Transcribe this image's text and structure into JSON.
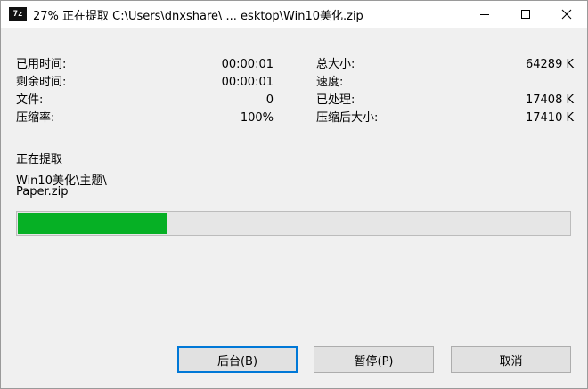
{
  "window": {
    "icon_text": "7z",
    "title": "27% 正在提取 C:\\Users\\dnxshare\\ ... esktop\\Win10美化.zip",
    "controls": [
      "minimize",
      "maximize",
      "close"
    ]
  },
  "stats_left": [
    {
      "label": "已用时间:",
      "value": "00:00:01"
    },
    {
      "label": "剩余时间:",
      "value": "00:00:01"
    },
    {
      "label": "文件:",
      "value": "0"
    },
    {
      "label": "压缩率:",
      "value": "100%"
    }
  ],
  "stats_right": [
    {
      "label": "总大小:",
      "value": "64289 K"
    },
    {
      "label": "速度:",
      "value": ""
    },
    {
      "label": "已处理:",
      "value": "17408 K"
    },
    {
      "label": "压缩后大小:",
      "value": "17410 K"
    }
  ],
  "status": {
    "label": "正在提取",
    "path_line1": "Win10美化\\主题\\",
    "path_line2": "Paper.zip"
  },
  "progress": {
    "percent": 27,
    "fill_color": "#06b025"
  },
  "buttons": {
    "background": "后台(B)",
    "pause": "暂停(P)",
    "cancel": "取消"
  }
}
